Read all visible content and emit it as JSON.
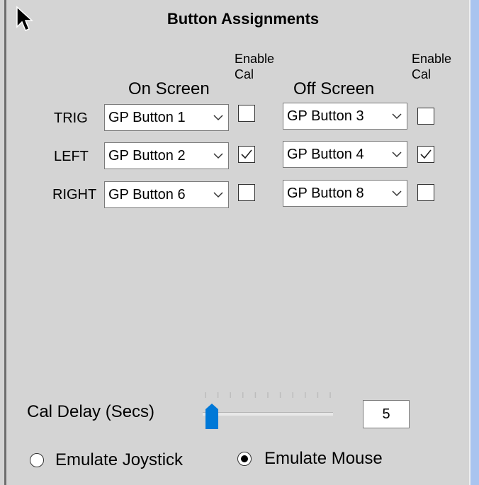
{
  "window": {
    "title": "Button Assignments"
  },
  "headers": {
    "on_screen": "On Screen",
    "off_screen": "Off Screen",
    "enable_line1": "Enable",
    "enable_line2": "Cal"
  },
  "rows": [
    {
      "label": "TRIG",
      "on_value": "GP Button 1",
      "on_enable_cal": false,
      "off_value": "GP Button 3",
      "off_enable_cal": false
    },
    {
      "label": "LEFT",
      "on_value": "GP Button 2",
      "on_enable_cal": true,
      "off_value": "GP Button 4",
      "off_enable_cal": true
    },
    {
      "label": "RIGHT",
      "on_value": "GP Button 6",
      "on_enable_cal": false,
      "off_value": "GP Button 8",
      "off_enable_cal": false
    }
  ],
  "cal_delay": {
    "label": "Cal Delay (Secs)",
    "value": "5",
    "slider_fraction": 0.0
  },
  "emulation": {
    "joystick_label": "Emulate Joystick",
    "mouse_label": "Emulate Mouse",
    "selected": "mouse"
  },
  "icons": {
    "cursor": "arrow-cursor-icon",
    "dropdown": "chevron-down-icon",
    "check": "checkmark-icon"
  },
  "colors": {
    "background": "#d4d4d4",
    "accent": "#0078d7",
    "right_strip": "#a9c4ef"
  }
}
